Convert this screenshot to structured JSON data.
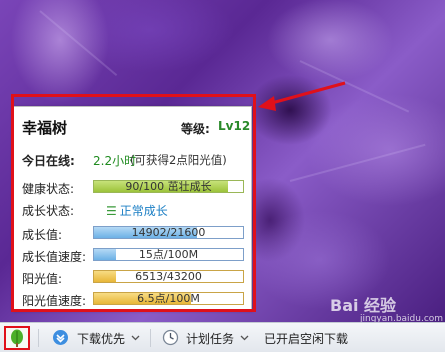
{
  "card": {
    "title": "幸福树",
    "level_label": "等级:",
    "level_value": "Lv12",
    "online": {
      "label": "今日在线:",
      "value": "2.2小时",
      "note": "(可获得2点阳光值)"
    },
    "rows": {
      "health": {
        "label": "健康状态:",
        "text": "90/100 茁壮成长",
        "fraction": 0.9
      },
      "growth_status": {
        "label": "成长状态:",
        "text": "正常成长"
      },
      "growth_value": {
        "label": "成长值:",
        "text": "14902/21600",
        "fraction": 0.69
      },
      "growth_speed": {
        "label": "成长值速度:",
        "text": "15点/100M",
        "fraction": 0.15
      },
      "sunlight": {
        "label": "阳光值:",
        "text": "6513/43200",
        "fraction": 0.15
      },
      "sunlight_speed": {
        "label": "阳光值速度:",
        "text": "6.5点/100M",
        "fraction": 0.65
      }
    }
  },
  "taskbar": {
    "download_priority": "下载优先",
    "scheduled_task": "计划任务",
    "idle_download": "已开启空闲下载"
  },
  "watermark": {
    "text": "Bai 经验",
    "sub": "jingyan.baidu.com"
  },
  "colors": {
    "highlight_red": "#e0101a",
    "level_green": "#2a8a2a",
    "status_blue": "#1a7ec4"
  },
  "icons": [
    "tree-leaf-icon",
    "download-priority-icon",
    "chevron-down-icon",
    "clock-icon",
    "chevron-down-icon"
  ]
}
